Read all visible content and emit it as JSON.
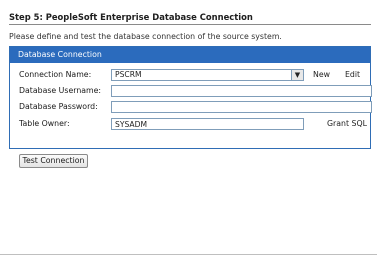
{
  "step": {
    "title": "Step 5:  PeopleSoft Enterprise Database Connection",
    "description": "Please define and test the database connection of the source system."
  },
  "panel": {
    "header": "Database Connection",
    "connection_name": {
      "label": "Connection Name:",
      "value": "PSCRM",
      "new_label": "New",
      "edit_label": "Edit"
    },
    "db_username": {
      "label": "Database Username:",
      "value": ""
    },
    "db_password": {
      "label": "Database Password:",
      "value": ""
    },
    "table_owner": {
      "label": "Table Owner:",
      "value": "SYSADM",
      "grant_label": "Grant SQL"
    }
  },
  "actions": {
    "test_connection": "Test Connection"
  },
  "colors": {
    "accent": "#2b6bbd",
    "border": "#7f9db9"
  }
}
